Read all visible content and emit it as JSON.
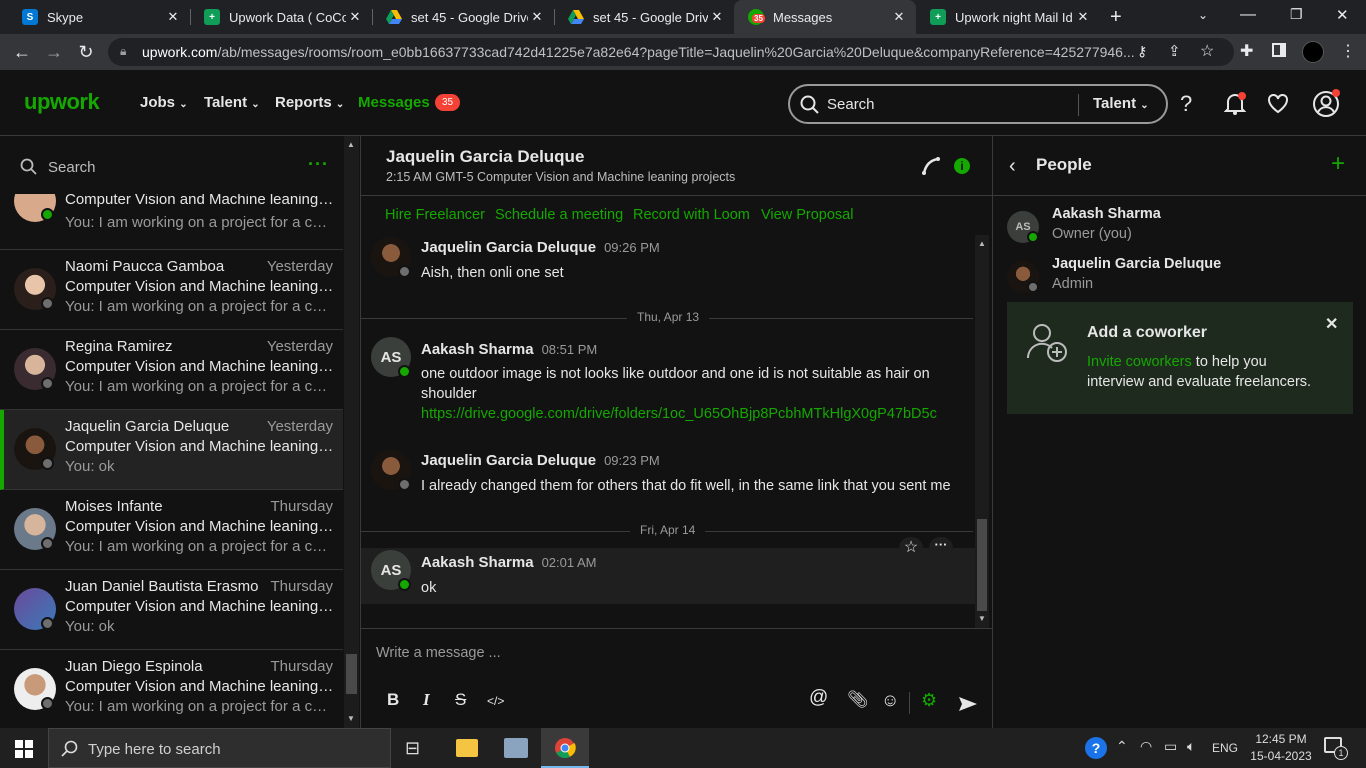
{
  "browser": {
    "tabs": [
      {
        "title": "Skype",
        "icon": "skype-icon",
        "color": "#0078d4"
      },
      {
        "title": "Upwork Data ( CoCo) I",
        "icon": "sheets-icon",
        "color": "#0f9d58"
      },
      {
        "title": "set 45 - Google Drive",
        "icon": "drive-icon",
        "color": "#fbbc04"
      },
      {
        "title": "set 45 - Google Drive",
        "icon": "drive-icon",
        "color": "#fbbc04"
      },
      {
        "title": "Messages",
        "icon": "upwork-icon",
        "color": "#14a800",
        "badge": "35"
      },
      {
        "title": "Upwork night Mail Id",
        "icon": "sheets-icon",
        "color": "#0f9d58"
      }
    ],
    "url_host": "upwork.com",
    "url_path": "/ab/messages/rooms/room_e0bb16637733cad742d41225e7a82e64?pageTitle=Jaquelin%20Garcia%20Deluque&companyReference=425277946..."
  },
  "nav": {
    "logo": "upwork",
    "jobs": "Jobs",
    "talent": "Talent",
    "reports": "Reports",
    "messages": "Messages",
    "messages_badge": "35",
    "search_placeholder": "Search",
    "search_scope": "Talent"
  },
  "sidebar": {
    "search_placeholder": "Search",
    "partial_top_sub": "Computer Vision and Machine leaning p...",
    "partial_top_prev": "You: I am working on a project for a com...",
    "conversations": [
      {
        "name": "Naomi Paucca Gamboa",
        "date": "Yesterday",
        "subject": "Computer Vision and Machine leaning p...",
        "preview": "You: I am working on a project for a com..."
      },
      {
        "name": "Regina Ramirez",
        "date": "Yesterday",
        "subject": "Computer Vision and Machine leaning p...",
        "preview": "You: I am working on a project for a com..."
      },
      {
        "name": "Jaquelin Garcia Deluque",
        "date": "Yesterday",
        "subject": "Computer Vision and Machine leaning p...",
        "preview": "You: ok"
      },
      {
        "name": "Moises Infante",
        "date": "Thursday",
        "subject": "Computer Vision and Machine leaning p...",
        "preview": "You: I am working on a project for a com..."
      },
      {
        "name": "Juan Daniel Bautista Erasmo",
        "date": "Thursday",
        "subject": "Computer Vision and Machine leaning p...",
        "preview": "You: ok"
      },
      {
        "name": "Juan Diego Espinola",
        "date": "Thursday",
        "subject": "Computer Vision and Machine leaning p...",
        "preview": "You: I am working on a project for a com..."
      }
    ]
  },
  "chat": {
    "title": "Jaquelin Garcia Deluque",
    "subtitle": "2:15 AM GMT-5  Computer Vision and Machine leaning projects",
    "actions": [
      "Hire Freelancer",
      "Schedule a meeting",
      "Record with Loom",
      "View Proposal"
    ],
    "messages": [
      {
        "sender": "Jaquelin Garcia Deluque",
        "time": "09:26 PM",
        "text": "Aish, then onli one set"
      },
      {
        "sender": "Aakash Sharma",
        "time": "08:51 PM",
        "initials": "AS",
        "text": "one outdoor image is not looks like outdoor and one id is not suitable as hair on shoulder",
        "link": "https://drive.google.com/drive/folders/1oc_U65OhBjp8PcbhMTkHlgX0gP47bD5c"
      },
      {
        "sender": "Jaquelin Garcia Deluque",
        "time": "09:23 PM",
        "text": "I already changed them for others that do fit well, in the same link that you sent me"
      },
      {
        "sender": "Aakash Sharma",
        "time": "02:01 AM",
        "initials": "AS",
        "text": "ok"
      }
    ],
    "day_thu": "Thu, Apr 13",
    "day_fri": "Fri, Apr 14",
    "composer_placeholder": "Write a message ..."
  },
  "people": {
    "title": "People",
    "members": [
      {
        "name": "Aakash Sharma",
        "role": "Owner (you)",
        "initials": "AS"
      },
      {
        "name": "Jaquelin Garcia Deluque",
        "role": "Admin"
      }
    ],
    "card_title": "Add a coworker",
    "card_link": "Invite coworkers",
    "card_text_1": " to help you",
    "card_text_2": "interview and evaluate freelancers."
  },
  "taskbar": {
    "search_placeholder": "Type here to search",
    "lang": "ENG",
    "time": "12:45 PM",
    "date": "15-04-2023",
    "notif_count": "1"
  },
  "colors": {
    "accent": "#14a800",
    "danger": "#f44336"
  }
}
